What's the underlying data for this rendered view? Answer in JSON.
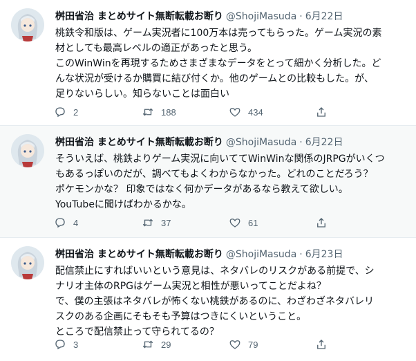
{
  "colors": {
    "text_primary": "#0f1419",
    "text_secondary": "#536471",
    "highlight_background": "#f7f9f9",
    "separator": "#e6ecf0"
  },
  "icons": {
    "reply": "reply-icon",
    "retweet": "retweet-icon",
    "like": "heart-icon",
    "share": "share-icon"
  },
  "tweets": [
    {
      "author_name": "桝田省治 まとめサイト無断転載お断り",
      "handle": "@ShojiMasuda",
      "separator": "·",
      "date": "6月22日",
      "lines": [
        "桃鉄令和版は、ゲーム実況者に100万本は売ってもらった。ゲーム実況の素",
        "材としても最高レベルの適正があったと思う。",
        "このWinWinを再現するためさまざまなデータをとって細かく分析した。ど",
        "んな状況が受けるか購買に結び付くか。他のゲームとの比較もした。が、",
        "足りないらしい。知らないことは面白い"
      ],
      "replies": "2",
      "retweets": "188",
      "likes": "434"
    },
    {
      "author_name": "桝田省治 まとめサイト無断転載お断り",
      "handle": "@ShojiMasuda",
      "separator": "·",
      "date": "6月22日",
      "lines": [
        "そういえば、桃鉄よりゲーム実況に向いててWinWinな関係のJRPGがいくつ",
        "もあるっぽいのだが、調べてもよくわからなかった。どれのことだろう？",
        "ポケモンかな？ 印象ではなく何かデータがあるなら教えて欲しい。",
        "YouTubeに聞けばわかるかな。"
      ],
      "replies": "4",
      "retweets": "37",
      "likes": "61"
    },
    {
      "author_name": "桝田省治 まとめサイト無断転載お断り",
      "handle": "@ShojiMasuda",
      "separator": "·",
      "date": "6月23日",
      "lines": [
        "配信禁止にすればいいという意見は、ネタバレのリスクがある前提で、シ",
        "ナリオ主体のRPGはゲーム実況と相性が悪いってことだよね？",
        "で、僕の主張はネタバレが怖くない桃鉄があるのに、わざわざネタバレリ",
        "スクのある企画にそもそも予算はつきにくいということ。",
        "ところで配信禁止って守られてるの？"
      ],
      "replies": "3",
      "retweets": "29",
      "likes": "79"
    }
  ]
}
